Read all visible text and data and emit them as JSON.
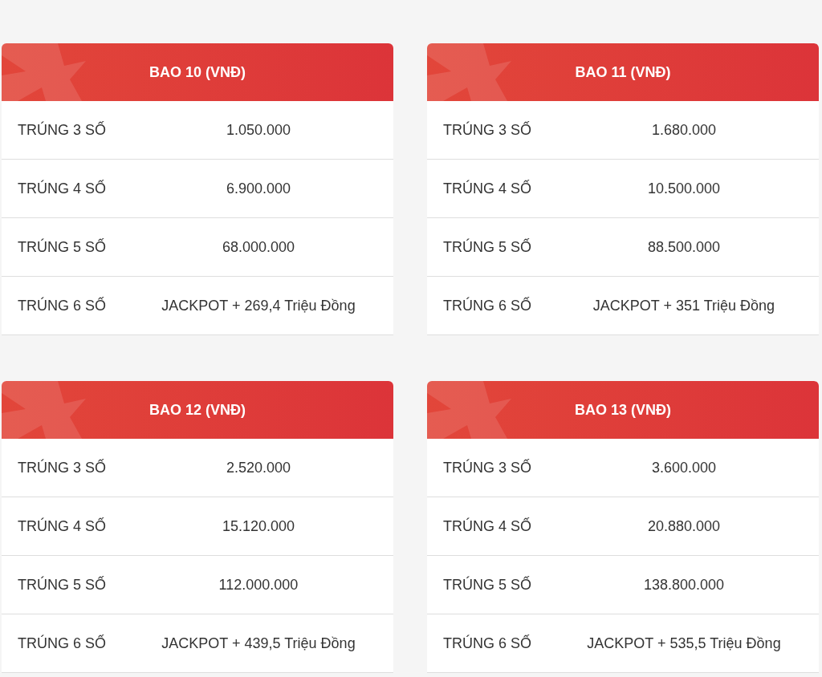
{
  "cards": [
    {
      "title": "BAO 10 (VNĐ)",
      "rows": [
        {
          "label": "TRÚNG 3 SỐ",
          "value": "1.050.000"
        },
        {
          "label": "TRÚNG 4 SỐ",
          "value": "6.900.000"
        },
        {
          "label": "TRÚNG 5 SỐ",
          "value": "68.000.000"
        },
        {
          "label": "TRÚNG 6 SỐ",
          "value": "JACKPOT + 269,4 Triệu Đồng"
        }
      ]
    },
    {
      "title": "BAO 11 (VNĐ)",
      "rows": [
        {
          "label": "TRÚNG 3 SỐ",
          "value": "1.680.000"
        },
        {
          "label": "TRÚNG 4 SỐ",
          "value": "10.500.000"
        },
        {
          "label": "TRÚNG 5 SỐ",
          "value": "88.500.000"
        },
        {
          "label": "TRÚNG 6 SỐ",
          "value": "JACKPOT + 351 Triệu Đồng"
        }
      ]
    },
    {
      "title": "BAO 12 (VNĐ)",
      "rows": [
        {
          "label": "TRÚNG 3 SỐ",
          "value": "2.520.000"
        },
        {
          "label": "TRÚNG 4 SỐ",
          "value": "15.120.000"
        },
        {
          "label": "TRÚNG 5 SỐ",
          "value": "112.000.000"
        },
        {
          "label": "TRÚNG 6 SỐ",
          "value": "JACKPOT + 439,5 Triệu Đồng"
        }
      ]
    },
    {
      "title": "BAO 13 (VNĐ)",
      "rows": [
        {
          "label": "TRÚNG 3 SỐ",
          "value": "3.600.000"
        },
        {
          "label": "TRÚNG 4 SỐ",
          "value": "20.880.000"
        },
        {
          "label": "TRÚNG 5 SỐ",
          "value": "138.800.000"
        },
        {
          "label": "TRÚNG 6 SỐ",
          "value": "JACKPOT + 535,5 Triệu Đồng"
        }
      ]
    }
  ]
}
